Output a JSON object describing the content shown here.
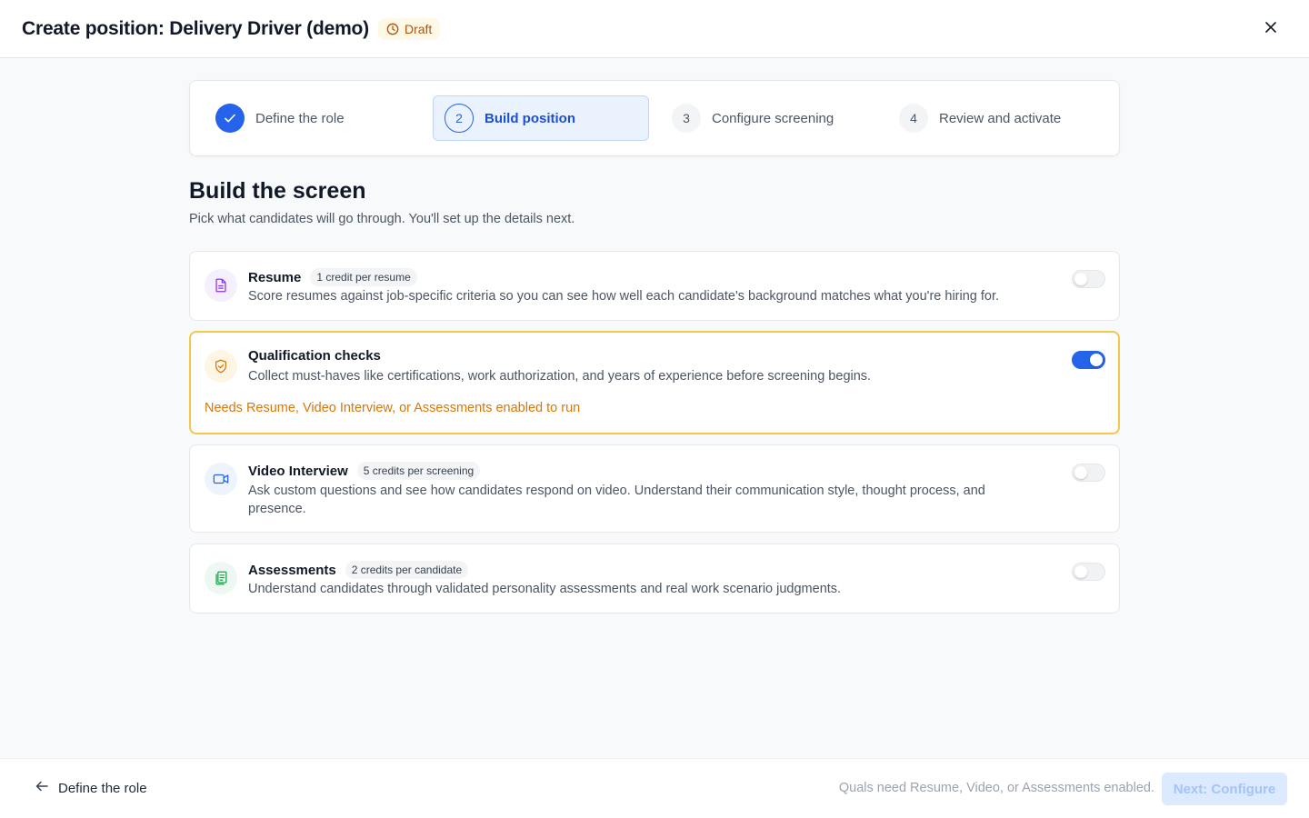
{
  "header": {
    "title": "Create position: Delivery Driver (demo)",
    "badge": "Draft",
    "close_icon": "close-icon"
  },
  "steps": [
    {
      "number": "",
      "label": "Define the role",
      "state": "done"
    },
    {
      "number": "2",
      "label": "Build position",
      "state": "active"
    },
    {
      "number": "3",
      "label": "Configure screening",
      "state": "pending"
    },
    {
      "number": "4",
      "label": "Review and activate",
      "state": "pending"
    }
  ],
  "main": {
    "heading": "Build the screen",
    "subheading": "Pick what candidates will go through. You'll set up the details next."
  },
  "cards": [
    {
      "name": "Resume",
      "pill": "1 credit per resume",
      "description": "Score resumes against job-specific criteria so you can see how well each candidate's background matches what you're hiring for.",
      "enabled": false,
      "icon": "document-icon"
    },
    {
      "name": "Qualification checks",
      "pill": "",
      "description": "Collect must-haves like certifications, work authorization, and years of experience before screening begins.",
      "warning": "Needs Resume, Video Interview, or Assessments enabled to run",
      "enabled": true,
      "icon": "shield-check-icon"
    },
    {
      "name": "Video Interview",
      "pill": "5 credits per screening",
      "description": "Ask custom questions and see how candidates respond on video. Understand their communication style, thought process, and presence.",
      "enabled": false,
      "icon": "video-icon"
    },
    {
      "name": "Assessments",
      "pill": "2 credits per candidate",
      "description": "Understand candidates through validated personality assessments and real work scenario judgments.",
      "enabled": false,
      "icon": "clipboard-icon"
    }
  ],
  "footer": {
    "back_label": "Define the role",
    "hint": "Quals need Resume, Video, or Assessments enabled.",
    "next_label": "Next: Configure"
  },
  "colors": {
    "accent": "#2563eb",
    "warning": "#d97706",
    "highlight_border": "#f5c84c"
  }
}
